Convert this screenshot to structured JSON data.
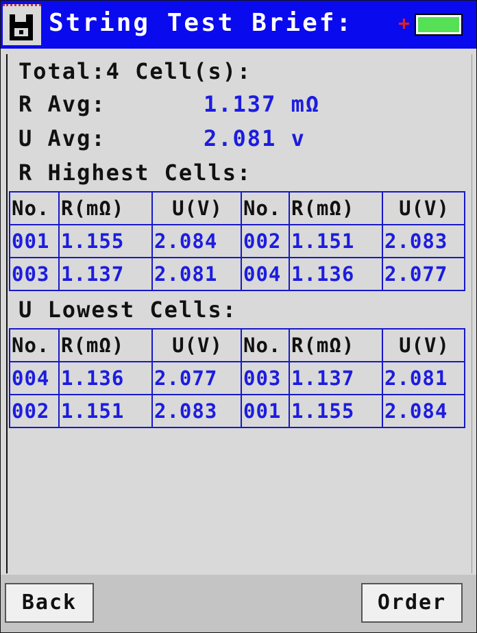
{
  "title": "String Test Brief:",
  "battery": {
    "charge_symbol": "+",
    "color": "#55e055"
  },
  "summary": {
    "total_label": "Total:4 Cell(s):",
    "r_avg_label": "R Avg:",
    "r_avg_value": "1.137 mΩ",
    "u_avg_label": "U Avg:",
    "u_avg_value": "2.081 v"
  },
  "r_highest": {
    "heading": "R Highest Cells:",
    "headers": [
      "No.",
      "R(mΩ)",
      "U(V)",
      "No.",
      "R(mΩ)",
      "U(V)"
    ],
    "rows": [
      [
        "001",
        "1.155",
        "2.084",
        "002",
        "1.151",
        "2.083"
      ],
      [
        "003",
        "1.137",
        "2.081",
        "004",
        "1.136",
        "2.077"
      ]
    ]
  },
  "u_lowest": {
    "heading": "U Lowest Cells:",
    "headers": [
      "No.",
      "R(mΩ)",
      "U(V)",
      "No.",
      "R(mΩ)",
      "U(V)"
    ],
    "rows": [
      [
        "004",
        "1.136",
        "2.077",
        "003",
        "1.137",
        "2.081"
      ],
      [
        "002",
        "1.151",
        "2.083",
        "001",
        "1.155",
        "2.084"
      ]
    ]
  },
  "buttons": {
    "back": "Back",
    "order": "Order"
  },
  "colors": {
    "title_bar": "#0a0aee",
    "value_text": "#1c1ce0",
    "table_border": "#1818c8",
    "background": "#d9d9d9"
  }
}
